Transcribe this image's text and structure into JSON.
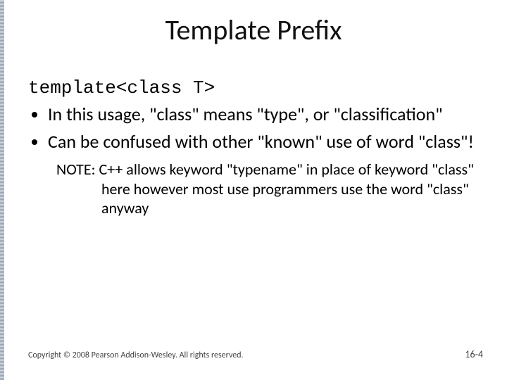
{
  "title": "Template Prefix",
  "code": "template<class T>",
  "bullets": [
    "In this usage, \"class\" means \"type\", or \"classification\"",
    "Can be confused with other \"known\" use of word \"class\"!"
  ],
  "note": "NOTE: C++ allows keyword \"typename\" in place of keyword \"class\" here however most use programmers use the word \"class\" anyway",
  "footer": {
    "copyright": "Copyright © 2008 Pearson Addison-Wesley. All rights reserved.",
    "page": "16-4"
  }
}
